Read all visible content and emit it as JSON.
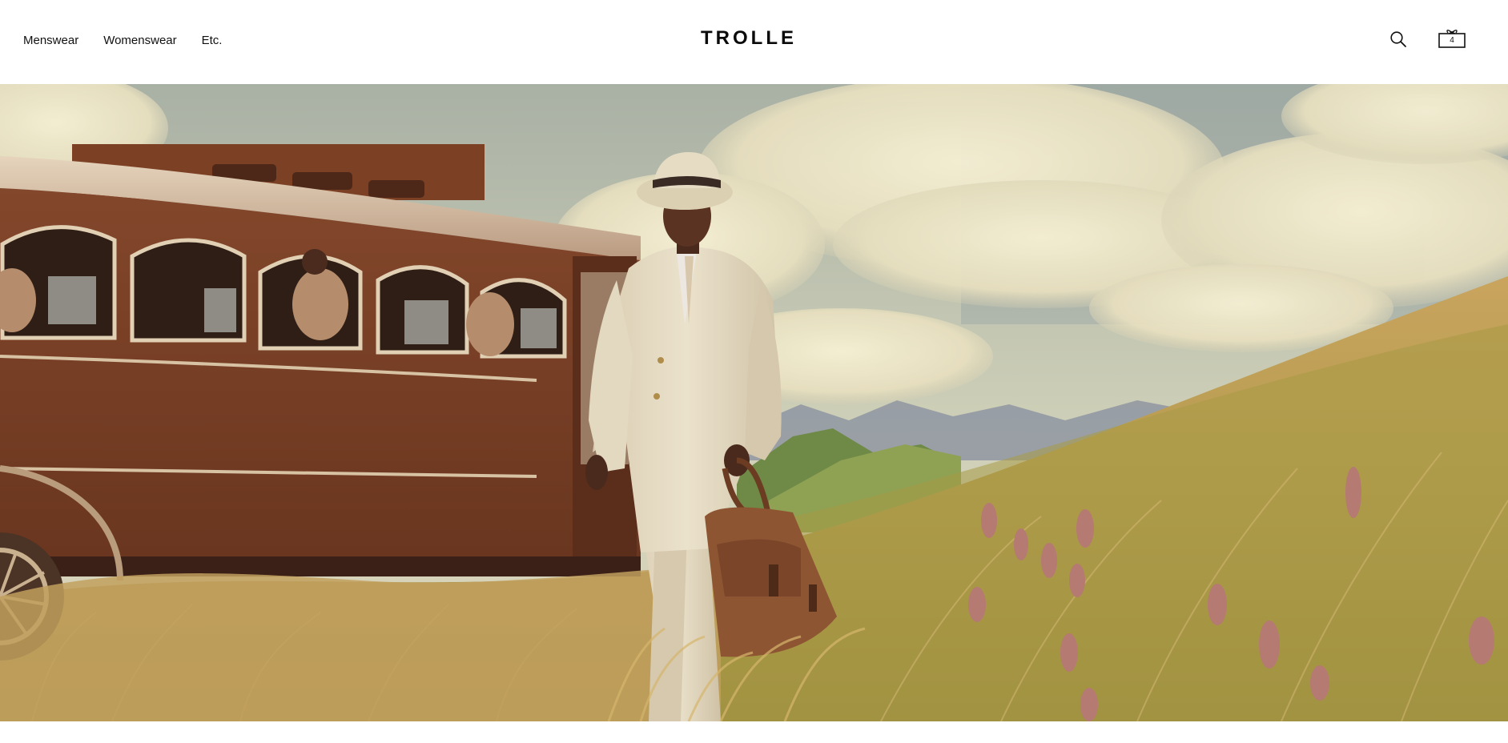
{
  "header": {
    "nav": [
      {
        "label": "Menswear"
      },
      {
        "label": "Womenswear"
      },
      {
        "label": "Etc."
      }
    ],
    "brand": "TROLLE",
    "cart_count": "4",
    "icons": {
      "search": "search-icon",
      "cart": "gift-box-cart-icon"
    }
  },
  "hero": {
    "image": "man-in-cream-suit-and-hat-carrying-brown-leather-bag-walking-through-tall-grass-beside-vintage-brown-tram",
    "colors": {
      "sky": "#aeb6a6",
      "cloud": "#efe9cc",
      "tram": "#7a4127",
      "grass": "#b8a156",
      "suit": "#e2d8c1",
      "bag": "#8a5230"
    }
  }
}
